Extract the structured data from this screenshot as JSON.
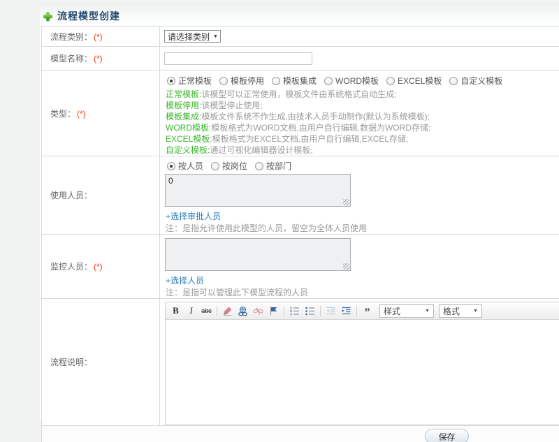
{
  "header": {
    "title": "流程模型创建"
  },
  "icons": {
    "caret_down": "▼",
    "blockquote_glyph": "”"
  },
  "colors": {
    "accent_green": "#3cb52c",
    "link_blue": "#2b7bbd",
    "required_red": "#ff3c00",
    "title_navy": "#2b4d72"
  },
  "rows": {
    "category": {
      "label": "流程类别：",
      "required": "(*)",
      "select_value": "请选择类别"
    },
    "name": {
      "label": "模型名称：",
      "required": "(*)",
      "input_value": ""
    },
    "type": {
      "label": "类型：",
      "required": "(*)",
      "options": [
        {
          "label": "正常模板",
          "checked": true
        },
        {
          "label": "模板停用",
          "checked": false
        },
        {
          "label": "模板集成",
          "checked": false
        },
        {
          "label": "WORD模板",
          "checked": false
        },
        {
          "label": "EXCEL模板",
          "checked": false
        },
        {
          "label": "自定义模板",
          "checked": false
        }
      ],
      "descriptions": [
        {
          "term": "正常模板:",
          "text": "该模型可以正常使用，模板文件由系统格式自动生成;"
        },
        {
          "term": "模板停用:",
          "text": "该模型停止使用;"
        },
        {
          "term": "模板集成:",
          "text": "模板文件系统不作生成,由技术人员手动制作(默认为系统模板);"
        },
        {
          "term": "WORD模板:",
          "text": "模板格式为WORD文档,由用户自行编辑,数据为WORD存储;"
        },
        {
          "term": "EXCEL模板:",
          "text": "模板格式为EXCEL文档,由用户自行编辑,EXCEL存储;"
        },
        {
          "term": "自定义模板:",
          "text": "通过可视化编辑器设计模板;"
        }
      ]
    },
    "users": {
      "label": "使用人员：",
      "options": [
        {
          "label": "按人员",
          "checked": true
        },
        {
          "label": "按岗位",
          "checked": false
        },
        {
          "label": "按部门",
          "checked": false
        }
      ],
      "textarea_value": "0",
      "link": "+选择审批人员",
      "note": "注：是指允许使用此模型的人员，留空为全体人员使用"
    },
    "monitors": {
      "label": "监控人员：",
      "required": "(*)",
      "textarea_value": "",
      "link": "+选择人员",
      "note": "注：是指可以管理此下模型流程的人员"
    },
    "description": {
      "label": "流程说明：",
      "toolbar": {
        "bold": "B",
        "italic": "I",
        "strike": "abc",
        "styles": "样式",
        "format": "格式"
      }
    }
  },
  "footer": {
    "save_label": "保存"
  }
}
